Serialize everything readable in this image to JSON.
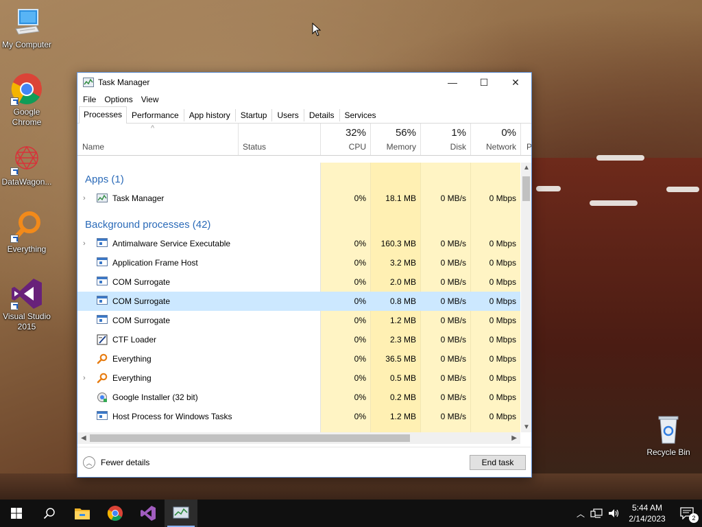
{
  "desktop": {
    "icons": [
      {
        "label": "My Computer",
        "icon": "computer-icon"
      },
      {
        "label": "Google Chrome",
        "icon": "chrome-icon"
      },
      {
        "label": "DataWagon...",
        "icon": "datawagon-icon"
      },
      {
        "label": "Everything",
        "icon": "everything-icon"
      },
      {
        "label": "Visual Studio 2015",
        "icon": "visual-studio-icon"
      },
      {
        "label": "Recycle Bin",
        "icon": "recycle-bin-icon"
      }
    ]
  },
  "window": {
    "title": "Task Manager",
    "controls": {
      "minimize": "—",
      "maximize": "☐",
      "close": "✕"
    },
    "menu": [
      "File",
      "Options",
      "View"
    ],
    "tabs": [
      "Processes",
      "Performance",
      "App history",
      "Startup",
      "Users",
      "Details",
      "Services"
    ],
    "active_tab": "Processes",
    "columns": {
      "name": "Name",
      "status": "Status",
      "cpu": {
        "pct": "32%",
        "label": "CPU"
      },
      "memory": {
        "pct": "56%",
        "label": "Memory"
      },
      "disk": {
        "pct": "1%",
        "label": "Disk"
      },
      "network": {
        "pct": "0%",
        "label": "Network"
      },
      "power": "P"
    },
    "groups": {
      "apps": "Apps (1)",
      "background": "Background processes (42)"
    },
    "apps_rows": [
      {
        "name": "Task Manager",
        "cpu": "0%",
        "memory": "18.1 MB",
        "disk": "0 MB/s",
        "network": "0 Mbps",
        "expandable": true,
        "icon": "task-manager-icon"
      }
    ],
    "bg_rows": [
      {
        "name": "Antimalware Service Executable",
        "cpu": "0%",
        "memory": "160.3 MB",
        "disk": "0 MB/s",
        "network": "0 Mbps",
        "expandable": true,
        "icon": "process-icon"
      },
      {
        "name": "Application Frame Host",
        "cpu": "0%",
        "memory": "3.2 MB",
        "disk": "0 MB/s",
        "network": "0 Mbps",
        "expandable": false,
        "icon": "process-icon"
      },
      {
        "name": "COM Surrogate",
        "cpu": "0%",
        "memory": "2.0 MB",
        "disk": "0 MB/s",
        "network": "0 Mbps",
        "expandable": false,
        "icon": "process-icon"
      },
      {
        "name": "COM Surrogate",
        "cpu": "0%",
        "memory": "0.8 MB",
        "disk": "0 MB/s",
        "network": "0 Mbps",
        "expandable": false,
        "icon": "process-icon",
        "selected": true
      },
      {
        "name": "COM Surrogate",
        "cpu": "0%",
        "memory": "1.2 MB",
        "disk": "0 MB/s",
        "network": "0 Mbps",
        "expandable": false,
        "icon": "process-icon"
      },
      {
        "name": "CTF Loader",
        "cpu": "0%",
        "memory": "2.3 MB",
        "disk": "0 MB/s",
        "network": "0 Mbps",
        "expandable": false,
        "icon": "ctf-loader-icon"
      },
      {
        "name": "Everything",
        "cpu": "0%",
        "memory": "36.5 MB",
        "disk": "0 MB/s",
        "network": "0 Mbps",
        "expandable": false,
        "icon": "everything-icon"
      },
      {
        "name": "Everything",
        "cpu": "0%",
        "memory": "0.5 MB",
        "disk": "0 MB/s",
        "network": "0 Mbps",
        "expandable": true,
        "icon": "everything-icon"
      },
      {
        "name": "Google Installer (32 bit)",
        "cpu": "0%",
        "memory": "0.2 MB",
        "disk": "0 MB/s",
        "network": "0 Mbps",
        "expandable": false,
        "icon": "google-installer-icon"
      },
      {
        "name": "Host Process for Windows Tasks",
        "cpu": "0%",
        "memory": "1.2 MB",
        "disk": "0 MB/s",
        "network": "0 Mbps",
        "expandable": false,
        "icon": "process-icon"
      }
    ],
    "footer": {
      "fewer_details": "Fewer details",
      "end_task": "End task"
    }
  },
  "taskbar": {
    "pinned": [
      "start-icon",
      "search-icon",
      "file-explorer-icon",
      "chrome-icon",
      "visual-studio-icon",
      "task-manager-icon"
    ],
    "active": "task-manager-icon",
    "clock": {
      "time": "5:44 AM",
      "date": "2/14/2023"
    },
    "notifications_count": "2"
  }
}
